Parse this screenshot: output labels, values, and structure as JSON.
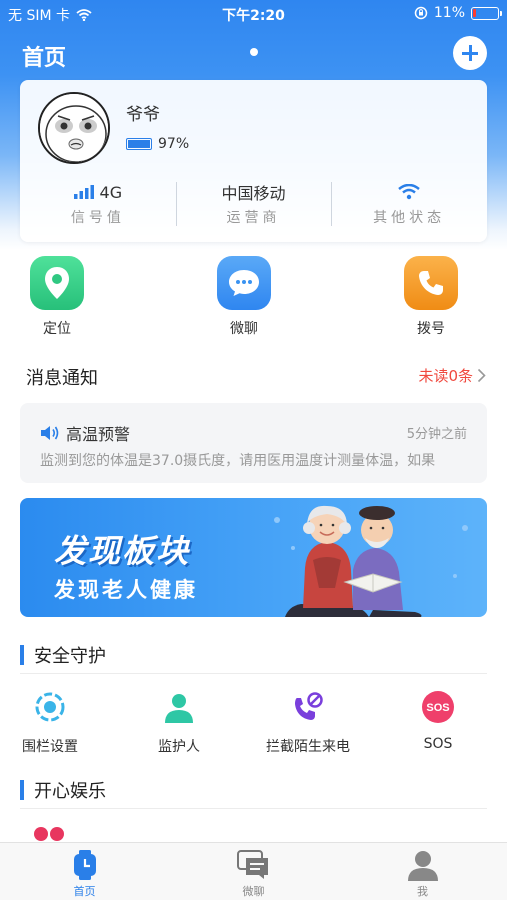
{
  "status_bar": {
    "carrier": "无 SIM 卡",
    "time": "下午2:20",
    "battery_pct": "11%"
  },
  "header": {
    "title": "首页"
  },
  "device": {
    "name": "爷爷",
    "battery": "97%",
    "stats": [
      {
        "value": "4G",
        "label": "信号值"
      },
      {
        "value": "中国移动",
        "label": "运营商"
      },
      {
        "value": "",
        "label": "其他状态"
      }
    ]
  },
  "quick_actions": [
    {
      "label": "定位",
      "icon": "location-pin-icon",
      "color": "#3ad18a"
    },
    {
      "label": "微聊",
      "icon": "chat-bubble-icon",
      "color": "#3a93f1"
    },
    {
      "label": "拨号",
      "icon": "phone-icon",
      "color": "#f59a23"
    }
  ],
  "messages": {
    "title": "消息通知",
    "unread": "未读0条",
    "card": {
      "title": "高温预警",
      "time": "5分钟之前",
      "body": "监测到您的体温是37.0摄氏度，请用医用温度计测量体温，如果"
    }
  },
  "banner": {
    "line1": "发现板块",
    "line2": "发现老人健康"
  },
  "safety": {
    "title": "安全守护",
    "items": [
      {
        "label": "围栏设置",
        "icon": "fence-icon"
      },
      {
        "label": "监护人",
        "icon": "guardian-icon"
      },
      {
        "label": "拦截陌生来电",
        "icon": "block-call-icon"
      },
      {
        "label": "SOS",
        "icon": "sos-icon",
        "badge": "SOS"
      }
    ]
  },
  "fun": {
    "title": "开心娱乐"
  },
  "tabbar": [
    {
      "label": "首页",
      "icon": "watch-home-icon"
    },
    {
      "label": "微聊",
      "icon": "chat-icon"
    },
    {
      "label": "我",
      "icon": "person-icon"
    }
  ],
  "colors": {
    "primary": "#2a7fe8",
    "alert": "#f0483e"
  }
}
